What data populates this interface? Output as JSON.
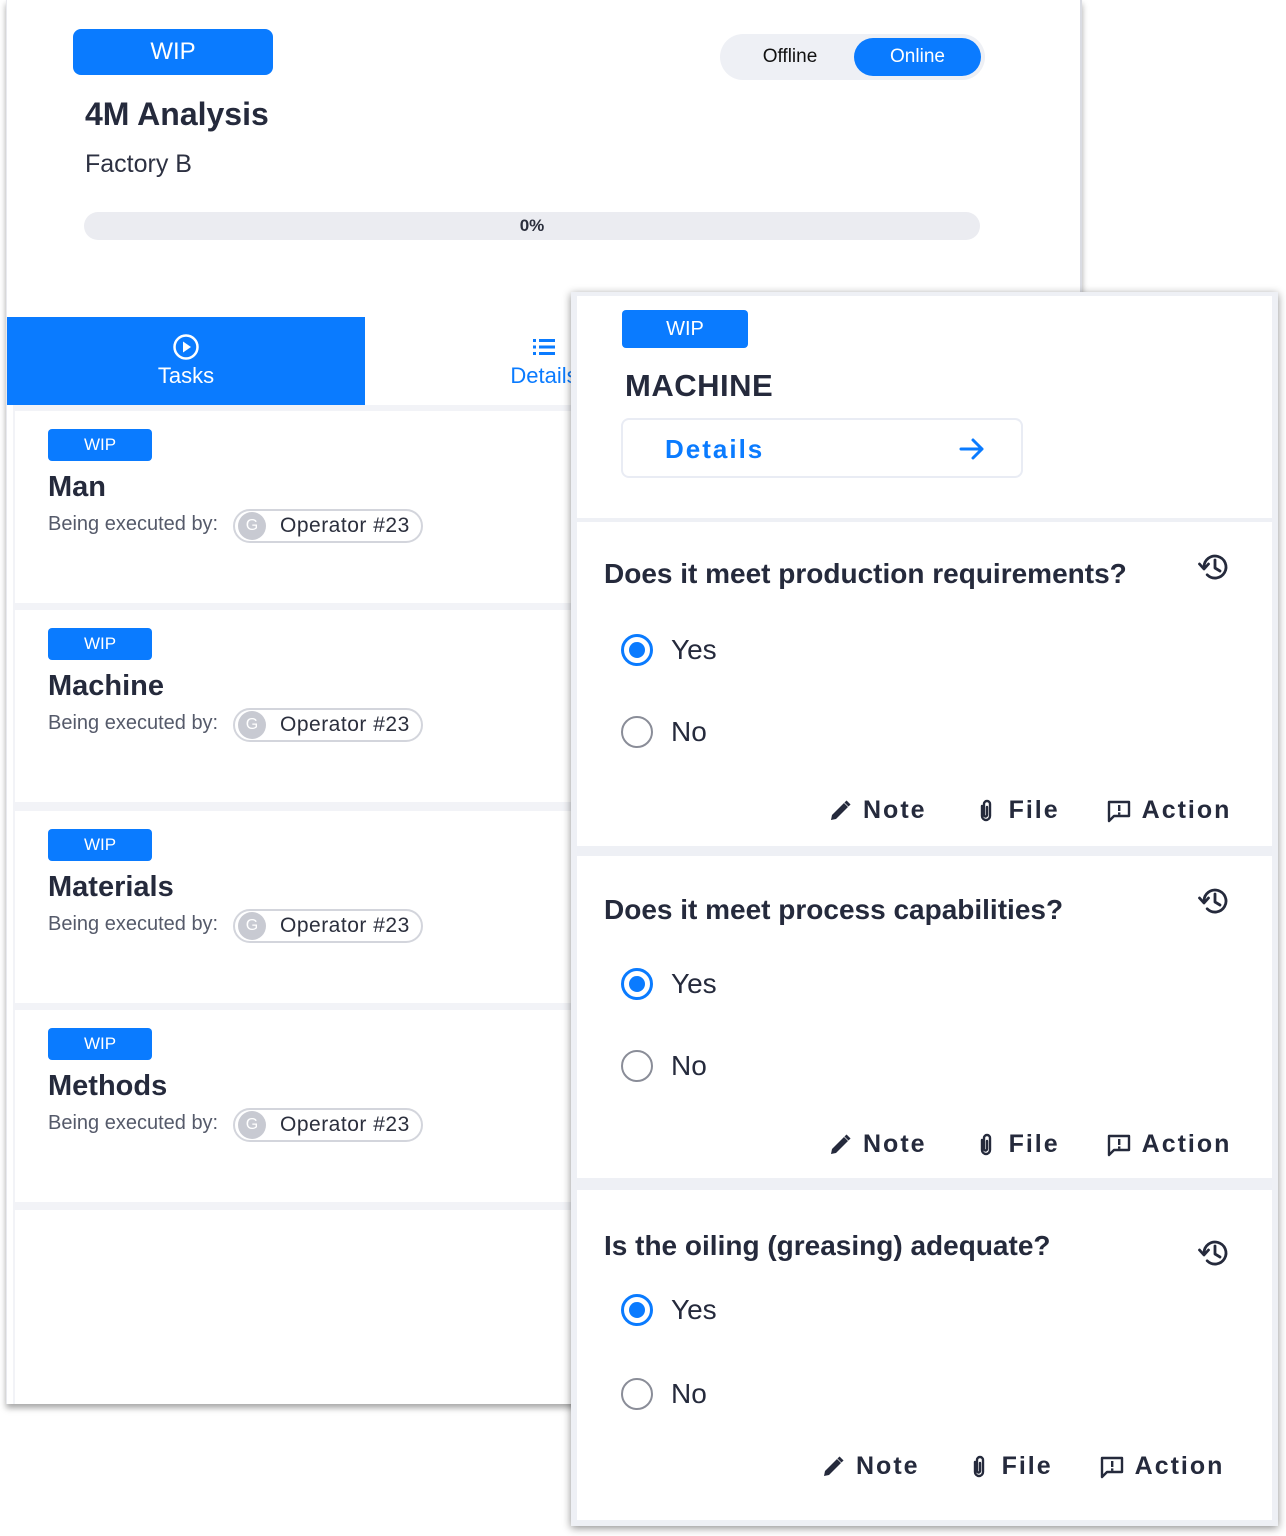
{
  "checklist": {
    "status": "WIP",
    "title": "4M Analysis",
    "subtitle": "Factory B",
    "progress": {
      "percent": 0,
      "label": "0%"
    }
  },
  "mode_toggle": {
    "offline_label": "Offline",
    "online_label": "Online",
    "selected": "Online"
  },
  "tabs": [
    {
      "label": "Tasks",
      "icon": "play-circle-icon",
      "active": true
    },
    {
      "label": "Details",
      "icon": "list-icon",
      "active": false
    }
  ],
  "tasks": [
    {
      "status": "WIP",
      "name": "Man",
      "executed_by_label": "Being executed by:",
      "avatar_initial": "G",
      "operator": "Operator #23"
    },
    {
      "status": "WIP",
      "name": "Machine",
      "executed_by_label": "Being executed by:",
      "avatar_initial": "G",
      "operator": "Operator #23"
    },
    {
      "status": "WIP",
      "name": "Materials",
      "executed_by_label": "Being executed by:",
      "avatar_initial": "G",
      "operator": "Operator #23"
    },
    {
      "status": "WIP",
      "name": "Methods",
      "executed_by_label": "Being executed by:",
      "avatar_initial": "G",
      "operator": "Operator #23"
    }
  ],
  "task_detail": {
    "status": "WIP",
    "title": "MACHINE",
    "details_label": "Details",
    "questions": [
      {
        "text": "Does it meet production requirements?",
        "options": [
          "Yes",
          "No"
        ],
        "selected": "Yes"
      },
      {
        "text": "Does it meet process capabilities?",
        "options": [
          "Yes",
          "No"
        ],
        "selected": "Yes"
      },
      {
        "text": "Is the oiling (greasing) adequate?",
        "options": [
          "Yes",
          "No"
        ],
        "selected": "Yes"
      }
    ],
    "actions": {
      "note": "Note",
      "file": "File",
      "action": "Action"
    }
  },
  "colors": {
    "accent": "#0a7bff",
    "text": "#252a3c",
    "surface": "#eef0f5"
  }
}
